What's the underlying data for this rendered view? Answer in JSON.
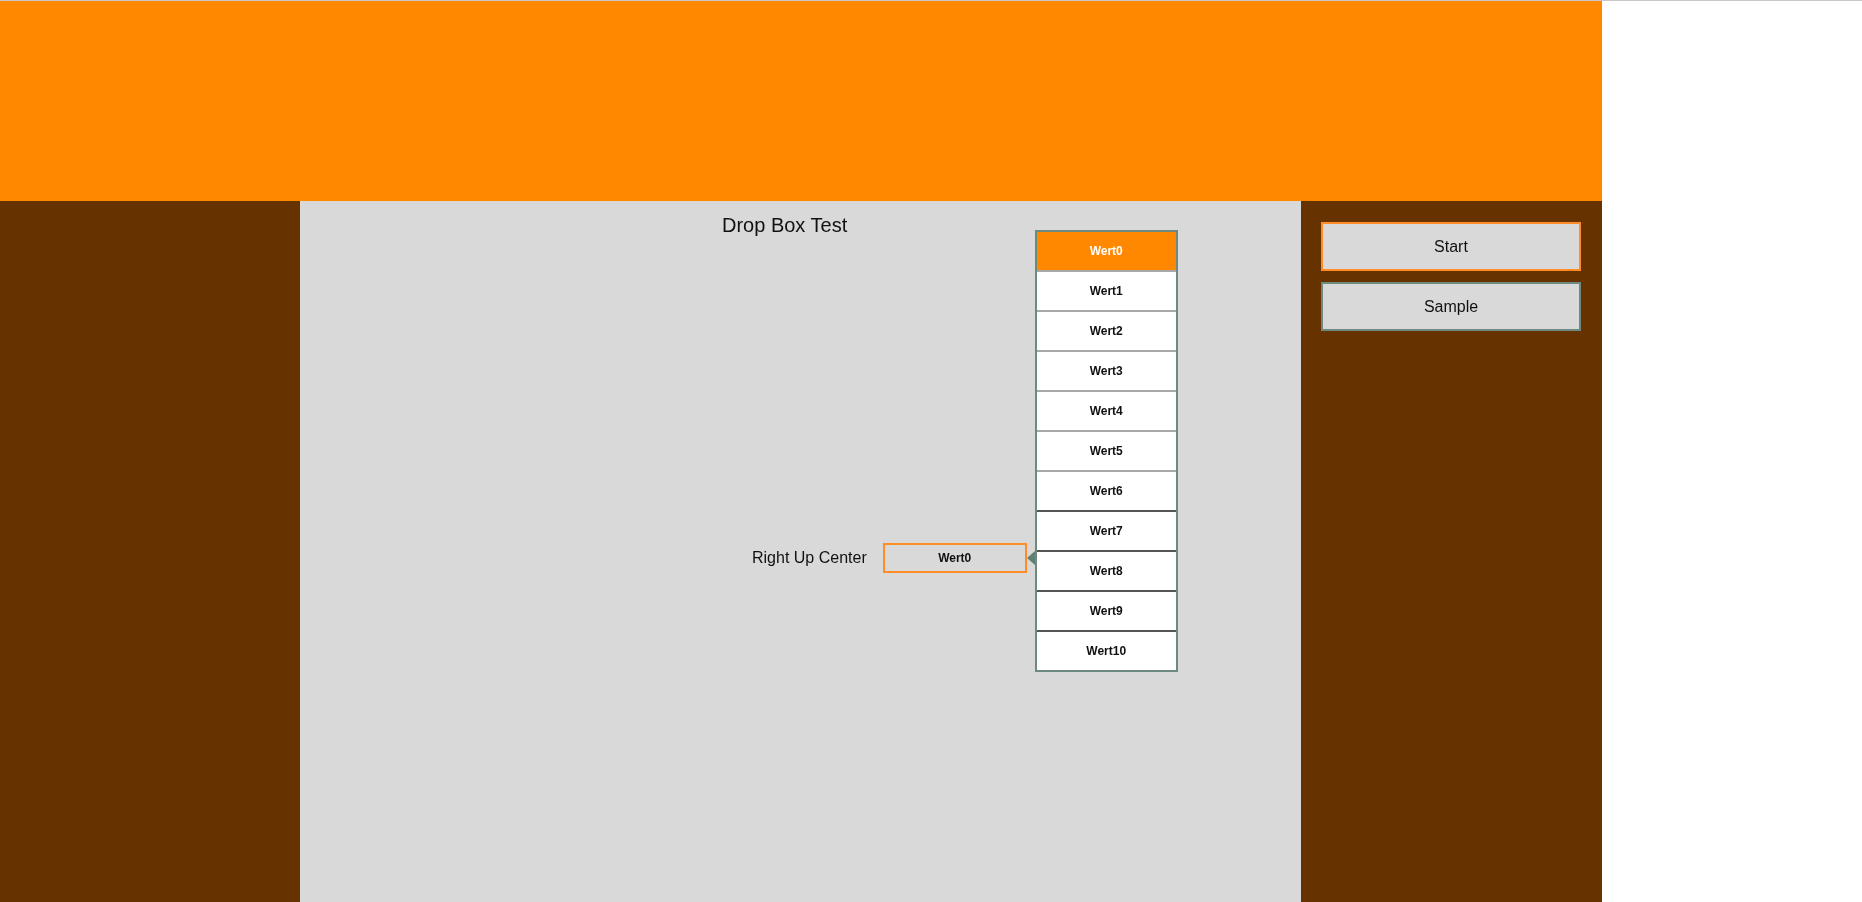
{
  "title": "Drop Box Test",
  "buttons": [
    {
      "label": "Start",
      "focused": true
    },
    {
      "label": "Sample",
      "focused": false
    }
  ],
  "dropdown": {
    "label": "Right Up Center",
    "value": "Wert0",
    "expanded": true,
    "options": [
      {
        "label": "Wert0",
        "selected": true
      },
      {
        "label": "Wert1",
        "selected": false
      },
      {
        "label": "Wert2",
        "selected": false
      },
      {
        "label": "Wert3",
        "selected": false
      },
      {
        "label": "Wert4",
        "selected": false
      },
      {
        "label": "Wert5",
        "selected": false
      },
      {
        "label": "Wert6",
        "selected": false
      },
      {
        "label": "Wert7",
        "selected": false
      },
      {
        "label": "Wert8",
        "selected": false
      },
      {
        "label": "Wert9",
        "selected": false
      },
      {
        "label": "Wert10",
        "selected": false
      }
    ]
  }
}
